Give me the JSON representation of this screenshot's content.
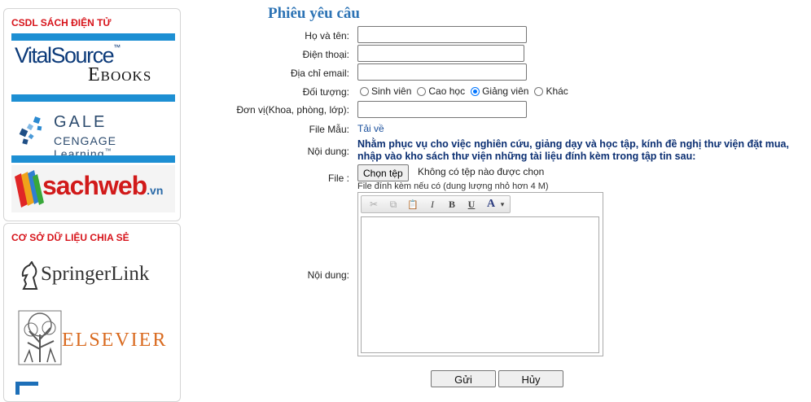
{
  "sidebar": {
    "ebooks_title": "CSDL SÁCH ĐIỆN TỬ",
    "shared_title": "CƠ SỞ DỮ LIỆU CHIA SẺ",
    "logos": {
      "vitalsource_1": "VitalSource",
      "vitalsource_tm": "™",
      "vitalsource_2": "Ebooks",
      "gale_1": "GALE",
      "gale_2": "CENGAGE Learning",
      "gale_tm": "™",
      "sachweb": "sachweb",
      "sachweb_vn": ".vn",
      "springer": "SpringerLink",
      "elsevier": "ELSEVIER"
    }
  },
  "form": {
    "title": "Phiêu yêu câu",
    "labels": {
      "name": "Họ và tên:",
      "phone": "Điện thoại:",
      "email": "Địa chỉ email:",
      "target": "Đối tượng:",
      "unit": "Đơn vị(Khoa, phòng, lớp):",
      "sample": "File Mẫu:",
      "content1": "Nội dung:",
      "file": "File :",
      "content2": "Nội dung:"
    },
    "values": {
      "name": "",
      "phone": "",
      "email": "",
      "unit": ""
    },
    "radio_options": [
      "Sinh viên",
      "Cao học",
      "Giảng viên",
      "Khác"
    ],
    "radio_selected": "Giảng viên",
    "sample_link": "Tải về",
    "description": "Nhằm phục vụ cho việc nghiên cứu, giảng dạy và học tập, kính đề nghị thư viện đặt mua, nhập vào kho sách thư viện những tài liệu đính kèm trong tập tin sau:",
    "choose_file": "Chọn tệp",
    "no_file": "Không có tệp nào được chọn",
    "file_hint": "File đính kèm nếu có (dung lượng nhỏ hơn 4 M)",
    "toolbar": {
      "cut_icon": "✂",
      "copy_icon": "⧉",
      "paste_icon": "📋",
      "italic": "I",
      "bold": "B",
      "underline": "U",
      "font_color": "A",
      "dropdown": "▾"
    },
    "submit": "Gửi",
    "cancel": "Hủy"
  }
}
